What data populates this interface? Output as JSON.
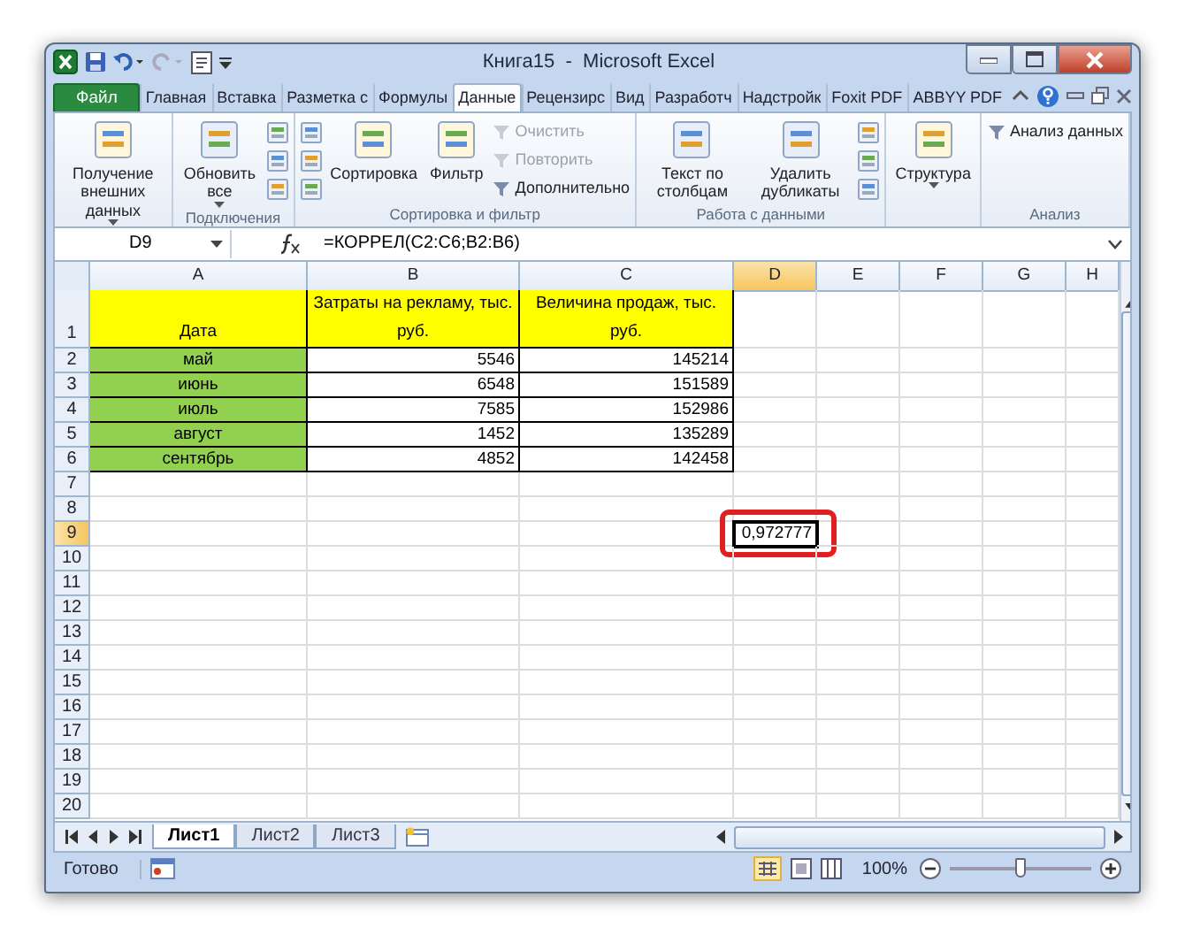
{
  "window": {
    "title": "Книга15  -  Microsoft Excel"
  },
  "file_tab": "Файл",
  "ribbon_tabs": [
    {
      "label": "Главная",
      "selected": false
    },
    {
      "label": "Вставка",
      "selected": false
    },
    {
      "label": "Разметка с",
      "selected": false
    },
    {
      "label": "Формулы",
      "selected": false
    },
    {
      "label": "Данные",
      "selected": true
    },
    {
      "label": "Рецензирс",
      "selected": false
    },
    {
      "label": "Вид",
      "selected": false
    },
    {
      "label": "Разработч",
      "selected": false
    },
    {
      "label": "Надстройк",
      "selected": false
    },
    {
      "label": "Foxit PDF",
      "selected": false
    },
    {
      "label": "ABBYY PDF",
      "selected": false
    }
  ],
  "ribbon_groups": [
    {
      "items": [
        {
          "kind": "large",
          "label": "Получение внешних данных",
          "dropdown": true
        }
      ]
    },
    {
      "label": "Подключения",
      "items": [
        {
          "kind": "large",
          "label": "Обновить все",
          "dropdown": true
        },
        {
          "kind": "icons"
        }
      ]
    },
    {
      "label": "Сортировка и фильтр",
      "items": [
        {
          "kind": "icons"
        },
        {
          "kind": "large",
          "label": "Сортировка",
          "dropdown": false
        },
        {
          "kind": "large",
          "label": "Фильтр",
          "dropdown": false
        },
        {
          "kind": "small",
          "entries": [
            {
              "label": "Очистить",
              "disabled": true
            },
            {
              "label": "Повторить",
              "disabled": true
            },
            {
              "label": "Дополнительно",
              "disabled": false
            }
          ]
        }
      ]
    },
    {
      "label": "Работа с данными",
      "items": [
        {
          "kind": "large",
          "label": "Текст по столбцам",
          "dropdown": false
        },
        {
          "kind": "large",
          "label": "Удалить дубликаты",
          "dropdown": false
        },
        {
          "kind": "icons"
        }
      ]
    },
    {
      "items": [
        {
          "kind": "large",
          "label": "Структура",
          "dropdown": true
        }
      ]
    },
    {
      "label": "Анализ",
      "items": [
        {
          "kind": "small",
          "entries": [
            {
              "label": "Анализ данных",
              "disabled": false
            }
          ]
        }
      ]
    }
  ],
  "formula_bar": {
    "name_box": "D9",
    "formula": "=КОРРЕЛ(C2:C6;B2:B6)"
  },
  "columns": [
    {
      "label": "A",
      "selected": false
    },
    {
      "label": "B",
      "selected": false
    },
    {
      "label": "C",
      "selected": false
    },
    {
      "label": "D",
      "selected": true
    },
    {
      "label": "E",
      "selected": false
    },
    {
      "label": "F",
      "selected": false
    },
    {
      "label": "G",
      "selected": false
    },
    {
      "label": "H",
      "selected": false
    }
  ],
  "rows": [
    {
      "label": "1",
      "selected": false,
      "tall": true,
      "cells": [
        {
          "kind": "header",
          "text": "Дата",
          "color": "#ffff00"
        },
        {
          "kind": "header",
          "text": "Затраты на рекламу, тыс. руб.",
          "color": "#ffff00"
        },
        {
          "kind": "header",
          "text": "Величина продаж, тыс. руб.",
          "color": "#ffff00"
        }
      ]
    },
    {
      "label": "2",
      "selected": false,
      "cells": [
        {
          "kind": "label",
          "text": "май",
          "color": "#92d050"
        },
        {
          "kind": "number",
          "text": "5546"
        },
        {
          "kind": "number",
          "text": "145214"
        }
      ]
    },
    {
      "label": "3",
      "selected": false,
      "cells": [
        {
          "kind": "label",
          "text": "июнь",
          "color": "#92d050"
        },
        {
          "kind": "number",
          "text": "6548"
        },
        {
          "kind": "number",
          "text": "151589"
        }
      ]
    },
    {
      "label": "4",
      "selected": false,
      "cells": [
        {
          "kind": "label",
          "text": "июль",
          "color": "#92d050"
        },
        {
          "kind": "number",
          "text": "7585"
        },
        {
          "kind": "number",
          "text": "152986"
        }
      ]
    },
    {
      "label": "5",
      "selected": false,
      "cells": [
        {
          "kind": "label",
          "text": "август",
          "color": "#92d050"
        },
        {
          "kind": "number",
          "text": "1452"
        },
        {
          "kind": "number",
          "text": "135289"
        }
      ]
    },
    {
      "label": "6",
      "selected": false,
      "cells": [
        {
          "kind": "label",
          "text": "сентябрь",
          "color": "#92d050"
        },
        {
          "kind": "number",
          "text": "4852"
        },
        {
          "kind": "number",
          "text": "142458"
        }
      ]
    },
    {
      "label": "7",
      "selected": false,
      "cells": []
    },
    {
      "label": "8",
      "selected": false,
      "cells": []
    },
    {
      "label": "9",
      "selected": true,
      "cells": [
        {
          "kind": "empty"
        },
        {
          "kind": "empty"
        },
        {
          "kind": "empty"
        },
        {
          "kind": "result",
          "text": "0,972777",
          "selected": true,
          "highlighted": true
        }
      ]
    },
    {
      "label": "10",
      "selected": false,
      "cells": []
    },
    {
      "label": "11",
      "selected": false,
      "cells": []
    },
    {
      "label": "12",
      "selected": false,
      "cells": []
    },
    {
      "label": "13",
      "selected": false,
      "cells": []
    },
    {
      "label": "14",
      "selected": false,
      "cells": []
    },
    {
      "label": "15",
      "selected": false,
      "cells": []
    },
    {
      "label": "16",
      "selected": false,
      "cells": []
    },
    {
      "label": "17",
      "selected": false,
      "cells": []
    },
    {
      "label": "18",
      "selected": false,
      "cells": []
    },
    {
      "label": "19",
      "selected": false,
      "cells": []
    },
    {
      "label": "20",
      "selected": false,
      "cells": []
    }
  ],
  "sheet_tabs": [
    {
      "label": "Лист1",
      "selected": true
    },
    {
      "label": "Лист2",
      "selected": false
    },
    {
      "label": "Лист3",
      "selected": false
    }
  ],
  "status_bar": {
    "status": "Готово",
    "zoom": "100%",
    "zoom_slider": {
      "level": 0.5
    }
  }
}
